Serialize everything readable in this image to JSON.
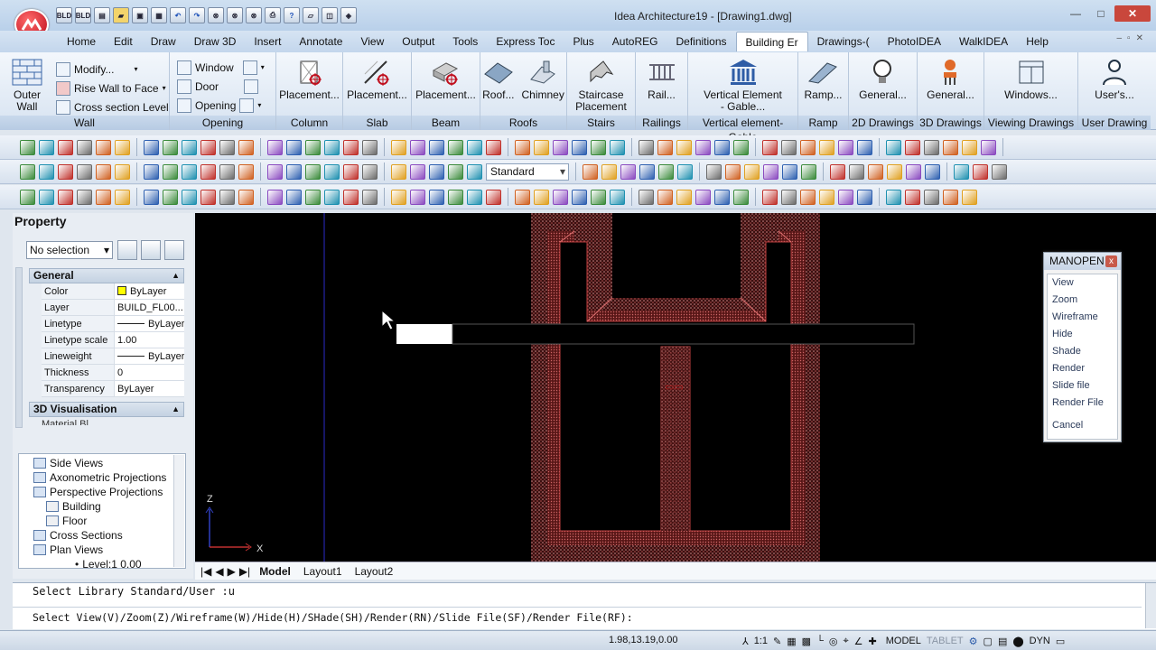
{
  "window": {
    "title": "Idea Architecture19 - [Drawing1.dwg]",
    "minimize": "—",
    "maximize": "□",
    "close": "✕"
  },
  "qat": {
    "bld_label": "BLD"
  },
  "tabs": [
    "Home",
    "Edit",
    "Draw",
    "Draw 3D",
    "Insert",
    "Annotate",
    "View",
    "Output",
    "Tools",
    "Express Toc",
    "Plus",
    "AutoREG",
    "Definitions",
    "Building Er",
    "Drawings-(",
    "PhotoIDEA",
    "WalkIDEA",
    "Help"
  ],
  "active_tab": "Building Er",
  "ribbon": {
    "wall": {
      "outer_wall": "Outer\nWall",
      "modify": "Modify...",
      "rise_wall": "Rise Wall to Face",
      "cross_section": "Cross section Level",
      "label": "Wall"
    },
    "opening": {
      "window": "Window",
      "door": "Door",
      "opening": "Opening",
      "label": "Opening"
    },
    "column": {
      "btn": "Placement...",
      "label": "Column"
    },
    "slab": {
      "btn": "Placement...",
      "label": "Slab"
    },
    "beam": {
      "btn": "Placement...",
      "label": "Beam"
    },
    "roofs": {
      "roof": "Roof...",
      "chimney": "Chimney",
      "label": "Roofs"
    },
    "stairs": {
      "btn": "Staircase\nPlacement",
      "label": "Stairs"
    },
    "railings": {
      "btn": "Rail...",
      "label": "Railings"
    },
    "vertical": {
      "btn": "Vertical Element\n- Gable...",
      "label": "Vertical element-Gable"
    },
    "ramp": {
      "btn": "Ramp...",
      "label": "Ramp"
    },
    "drawings2d": {
      "btn": "General...",
      "label": "2D Drawings"
    },
    "drawings3d": {
      "btn": "General...",
      "label": "3D Drawings"
    },
    "viewing": {
      "btn": "Windows...",
      "label": "Viewing Drawings"
    },
    "user": {
      "btn": "User's...",
      "label": "User Drawing"
    }
  },
  "toolbar": {
    "style_select": "Standard"
  },
  "property": {
    "title": "Property",
    "selection": "No selection",
    "general_header": "General",
    "rows": [
      {
        "key": "Color",
        "value": "ByLayer"
      },
      {
        "key": "Layer",
        "value": "BUILD_FL00..."
      },
      {
        "key": "Linetype",
        "value": "ByLayer"
      },
      {
        "key": "Linetype scale",
        "value": "1.00"
      },
      {
        "key": "Lineweight",
        "value": "ByLayer"
      },
      {
        "key": "Thickness",
        "value": "0"
      },
      {
        "key": "Transparency",
        "value": "ByLayer"
      }
    ],
    "visual_header": "3D Visualisation",
    "visual_partial": "Material    Bl..."
  },
  "tree": [
    {
      "label": "Side Views",
      "level": 1
    },
    {
      "label": "Axonometric Projections",
      "level": 1
    },
    {
      "label": "Perspective Projections",
      "level": 1
    },
    {
      "label": "Building",
      "level": 2
    },
    {
      "label": "Floor",
      "level": 2
    },
    {
      "label": "Cross Sections",
      "level": 1
    },
    {
      "label": "Plan Views",
      "level": 1
    },
    {
      "label": "Level:1  0.00",
      "level": 3
    }
  ],
  "canvas": {
    "axis_x": "X",
    "axis_z": "Z"
  },
  "layout_tabs": [
    "Model",
    "Layout1",
    "Layout2"
  ],
  "active_layout": "Model",
  "command": {
    "line1": "Select Library Standard/User :u",
    "line2": "Select View(V)/Zoom(Z)/Wireframe(W)/Hide(H)/SHade(SH)/Render(RN)/Slide File(SF)/Render File(RF):"
  },
  "status": {
    "coords": "1.98,13.19,0.00",
    "scale": "1:1",
    "model": "MODEL",
    "tablet": "TABLET",
    "dyn": "DYN"
  },
  "manopen": {
    "title": "MANOPEN",
    "items": [
      "View",
      "Zoom",
      "Wireframe",
      "Hide",
      "Shade",
      "Render",
      "Slide file",
      "Render File"
    ],
    "cancel": "Cancel"
  },
  "colors": {
    "accent": "#c0101e",
    "layer_color": "#ffff00",
    "wall_red": "#b3261e"
  }
}
